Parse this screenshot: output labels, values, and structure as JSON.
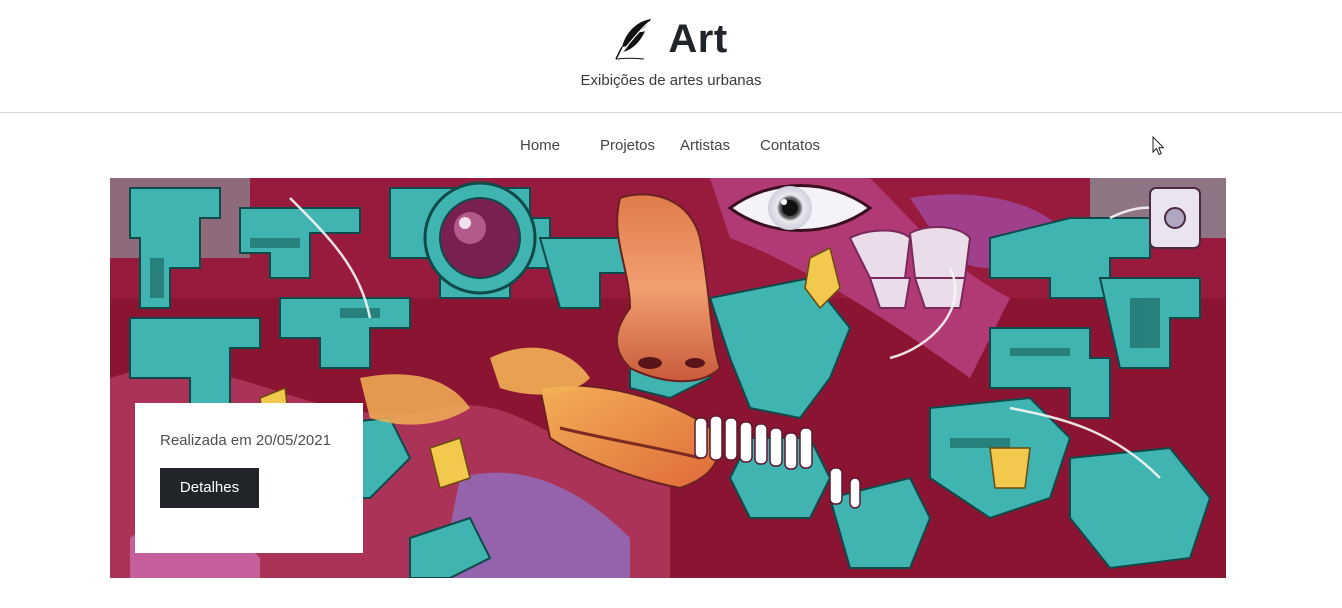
{
  "header": {
    "brand_title": "Art",
    "tagline": "Exibições de artes urbanas"
  },
  "nav": {
    "items": [
      {
        "label": "Home"
      },
      {
        "label": "Projetos"
      },
      {
        "label": "Artistas"
      },
      {
        "label": "Contatos"
      }
    ]
  },
  "hero": {
    "image": "graffiti-mural",
    "card": {
      "text": "Realizada em 20/05/2021",
      "button_label": "Detalhes"
    }
  },
  "icons": {
    "logo": "feather-quill-icon",
    "pointer": "mouse-cursor-icon"
  },
  "colors": {
    "text": "#212529",
    "button_bg": "#212529",
    "button_text": "#ffffff",
    "mural_teal": "#3fb4b0",
    "mural_red": "#8c1433"
  }
}
